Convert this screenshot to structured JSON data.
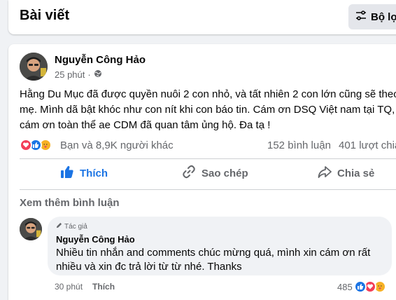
{
  "section": {
    "title": "Bài viết",
    "filter_label": "Bộ lọ"
  },
  "post": {
    "author": "Nguyễn Công Hảo",
    "time": "25 phút",
    "privacy_icon": "globe-icon",
    "text": "Hằng Du Mục đã được quyền nuôi 2 con nhỏ, và tất nhiên 2 con lớn cũng sẽ theo\nmẹ. Mình dã bật khóc như con nít khi con báo tin. Cám ơn DSQ Việt nam tại TQ,\ncám ơn toàn thể ae CDM đã quan tâm ủng hộ. Đa tạ !",
    "reactions_text": "Bạn và 8,9K người khác",
    "reaction_icons": [
      "love-icon",
      "like-icon",
      "care-icon"
    ],
    "comments_count": "152 bình luận",
    "shares_count": "401 lượt chia",
    "actions": {
      "like": "Thích",
      "copy": "Sao chép",
      "share": "Chia sẻ"
    },
    "more_comments": "Xem thêm bình luận"
  },
  "comment": {
    "badge": "Tác giả",
    "author": "Nguyễn Công Hảo",
    "text": "Nhiều tin nhắn and comments chúc mừng quá, mình xin cám ơn rất nhiều và xin đc trả lời từ từ nhé. Thanks",
    "time": "30 phút",
    "like_label": "Thích",
    "reaction_count": "485",
    "reaction_icons": [
      "like-icon",
      "love-icon",
      "care-icon"
    ]
  },
  "colors": {
    "like_blue": "#1b74e4",
    "love_red": "#f33e58",
    "care_yellow": "#f7b125",
    "secondary_text": "#65676b"
  }
}
